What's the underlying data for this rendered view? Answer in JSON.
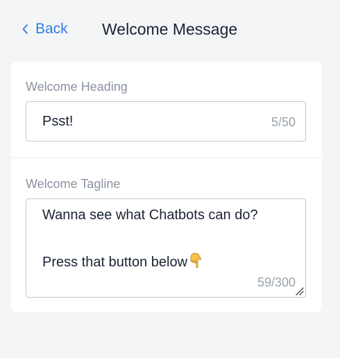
{
  "header": {
    "back_label": "Back",
    "title": "Welcome Message"
  },
  "colors": {
    "accent": "#2f7de1",
    "background": "#f4f5f7",
    "card": "#ffffff",
    "label": "#8a93a0",
    "border": "#c4c8cf"
  },
  "form": {
    "heading": {
      "label": "Welcome Heading",
      "value": "Psst!",
      "counter": "5/50"
    },
    "tagline": {
      "label": "Welcome Tagline",
      "lines": [
        "Wanna see what Chatbots can do?",
        "Press that button below"
      ],
      "emoji_icon": "pointing-down-hand-icon",
      "counter": "59/300"
    }
  }
}
